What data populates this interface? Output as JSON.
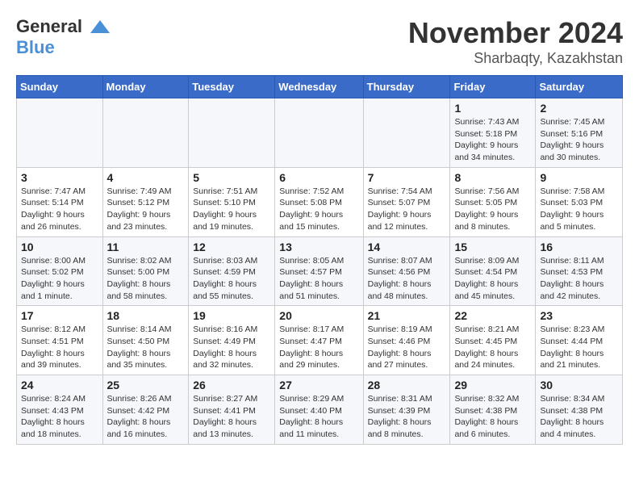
{
  "header": {
    "logo_line1": "General",
    "logo_line2": "Blue",
    "month": "November 2024",
    "location": "Sharbaqty, Kazakhstan"
  },
  "weekdays": [
    "Sunday",
    "Monday",
    "Tuesday",
    "Wednesday",
    "Thursday",
    "Friday",
    "Saturday"
  ],
  "weeks": [
    [
      {
        "day": "",
        "sunrise": "",
        "sunset": "",
        "daylight": ""
      },
      {
        "day": "",
        "sunrise": "",
        "sunset": "",
        "daylight": ""
      },
      {
        "day": "",
        "sunrise": "",
        "sunset": "",
        "daylight": ""
      },
      {
        "day": "",
        "sunrise": "",
        "sunset": "",
        "daylight": ""
      },
      {
        "day": "",
        "sunrise": "",
        "sunset": "",
        "daylight": ""
      },
      {
        "day": "1",
        "sunrise": "Sunrise: 7:43 AM",
        "sunset": "Sunset: 5:18 PM",
        "daylight": "Daylight: 9 hours and 34 minutes."
      },
      {
        "day": "2",
        "sunrise": "Sunrise: 7:45 AM",
        "sunset": "Sunset: 5:16 PM",
        "daylight": "Daylight: 9 hours and 30 minutes."
      }
    ],
    [
      {
        "day": "3",
        "sunrise": "Sunrise: 7:47 AM",
        "sunset": "Sunset: 5:14 PM",
        "daylight": "Daylight: 9 hours and 26 minutes."
      },
      {
        "day": "4",
        "sunrise": "Sunrise: 7:49 AM",
        "sunset": "Sunset: 5:12 PM",
        "daylight": "Daylight: 9 hours and 23 minutes."
      },
      {
        "day": "5",
        "sunrise": "Sunrise: 7:51 AM",
        "sunset": "Sunset: 5:10 PM",
        "daylight": "Daylight: 9 hours and 19 minutes."
      },
      {
        "day": "6",
        "sunrise": "Sunrise: 7:52 AM",
        "sunset": "Sunset: 5:08 PM",
        "daylight": "Daylight: 9 hours and 15 minutes."
      },
      {
        "day": "7",
        "sunrise": "Sunrise: 7:54 AM",
        "sunset": "Sunset: 5:07 PM",
        "daylight": "Daylight: 9 hours and 12 minutes."
      },
      {
        "day": "8",
        "sunrise": "Sunrise: 7:56 AM",
        "sunset": "Sunset: 5:05 PM",
        "daylight": "Daylight: 9 hours and 8 minutes."
      },
      {
        "day": "9",
        "sunrise": "Sunrise: 7:58 AM",
        "sunset": "Sunset: 5:03 PM",
        "daylight": "Daylight: 9 hours and 5 minutes."
      }
    ],
    [
      {
        "day": "10",
        "sunrise": "Sunrise: 8:00 AM",
        "sunset": "Sunset: 5:02 PM",
        "daylight": "Daylight: 9 hours and 1 minute."
      },
      {
        "day": "11",
        "sunrise": "Sunrise: 8:02 AM",
        "sunset": "Sunset: 5:00 PM",
        "daylight": "Daylight: 8 hours and 58 minutes."
      },
      {
        "day": "12",
        "sunrise": "Sunrise: 8:03 AM",
        "sunset": "Sunset: 4:59 PM",
        "daylight": "Daylight: 8 hours and 55 minutes."
      },
      {
        "day": "13",
        "sunrise": "Sunrise: 8:05 AM",
        "sunset": "Sunset: 4:57 PM",
        "daylight": "Daylight: 8 hours and 51 minutes."
      },
      {
        "day": "14",
        "sunrise": "Sunrise: 8:07 AM",
        "sunset": "Sunset: 4:56 PM",
        "daylight": "Daylight: 8 hours and 48 minutes."
      },
      {
        "day": "15",
        "sunrise": "Sunrise: 8:09 AM",
        "sunset": "Sunset: 4:54 PM",
        "daylight": "Daylight: 8 hours and 45 minutes."
      },
      {
        "day": "16",
        "sunrise": "Sunrise: 8:11 AM",
        "sunset": "Sunset: 4:53 PM",
        "daylight": "Daylight: 8 hours and 42 minutes."
      }
    ],
    [
      {
        "day": "17",
        "sunrise": "Sunrise: 8:12 AM",
        "sunset": "Sunset: 4:51 PM",
        "daylight": "Daylight: 8 hours and 39 minutes."
      },
      {
        "day": "18",
        "sunrise": "Sunrise: 8:14 AM",
        "sunset": "Sunset: 4:50 PM",
        "daylight": "Daylight: 8 hours and 35 minutes."
      },
      {
        "day": "19",
        "sunrise": "Sunrise: 8:16 AM",
        "sunset": "Sunset: 4:49 PM",
        "daylight": "Daylight: 8 hours and 32 minutes."
      },
      {
        "day": "20",
        "sunrise": "Sunrise: 8:17 AM",
        "sunset": "Sunset: 4:47 PM",
        "daylight": "Daylight: 8 hours and 29 minutes."
      },
      {
        "day": "21",
        "sunrise": "Sunrise: 8:19 AM",
        "sunset": "Sunset: 4:46 PM",
        "daylight": "Daylight: 8 hours and 27 minutes."
      },
      {
        "day": "22",
        "sunrise": "Sunrise: 8:21 AM",
        "sunset": "Sunset: 4:45 PM",
        "daylight": "Daylight: 8 hours and 24 minutes."
      },
      {
        "day": "23",
        "sunrise": "Sunrise: 8:23 AM",
        "sunset": "Sunset: 4:44 PM",
        "daylight": "Daylight: 8 hours and 21 minutes."
      }
    ],
    [
      {
        "day": "24",
        "sunrise": "Sunrise: 8:24 AM",
        "sunset": "Sunset: 4:43 PM",
        "daylight": "Daylight: 8 hours and 18 minutes."
      },
      {
        "day": "25",
        "sunrise": "Sunrise: 8:26 AM",
        "sunset": "Sunset: 4:42 PM",
        "daylight": "Daylight: 8 hours and 16 minutes."
      },
      {
        "day": "26",
        "sunrise": "Sunrise: 8:27 AM",
        "sunset": "Sunset: 4:41 PM",
        "daylight": "Daylight: 8 hours and 13 minutes."
      },
      {
        "day": "27",
        "sunrise": "Sunrise: 8:29 AM",
        "sunset": "Sunset: 4:40 PM",
        "daylight": "Daylight: 8 hours and 11 minutes."
      },
      {
        "day": "28",
        "sunrise": "Sunrise: 8:31 AM",
        "sunset": "Sunset: 4:39 PM",
        "daylight": "Daylight: 8 hours and 8 minutes."
      },
      {
        "day": "29",
        "sunrise": "Sunrise: 8:32 AM",
        "sunset": "Sunset: 4:38 PM",
        "daylight": "Daylight: 8 hours and 6 minutes."
      },
      {
        "day": "30",
        "sunrise": "Sunrise: 8:34 AM",
        "sunset": "Sunset: 4:38 PM",
        "daylight": "Daylight: 8 hours and 4 minutes."
      }
    ]
  ]
}
